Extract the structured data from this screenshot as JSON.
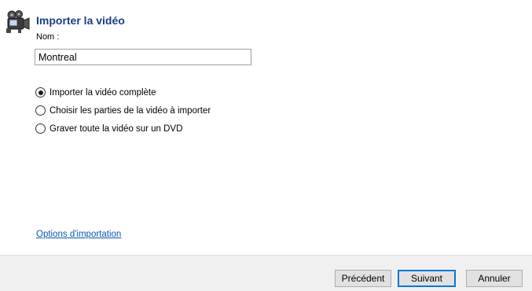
{
  "header": {
    "title": "Importer la vidéo",
    "icon": "camcorder-icon"
  },
  "name_field": {
    "label": "Nom :",
    "value": "Montreal"
  },
  "import_options": {
    "selected_index": 0,
    "items": [
      {
        "label": "Importer la vidéo complète",
        "checked": true
      },
      {
        "label": "Choisir les parties de la vidéo à importer",
        "checked": false
      },
      {
        "label": "Graver toute la vidéo sur un DVD",
        "checked": false
      }
    ]
  },
  "options_link": "Options d'importation",
  "buttons": {
    "previous": "Précédent",
    "next": "Suivant",
    "cancel": "Annuler"
  },
  "colors": {
    "title": "#1c3d85",
    "link": "#0a58b0",
    "default_button_border": "#0078d7",
    "footer_background": "#f0f0f0"
  }
}
